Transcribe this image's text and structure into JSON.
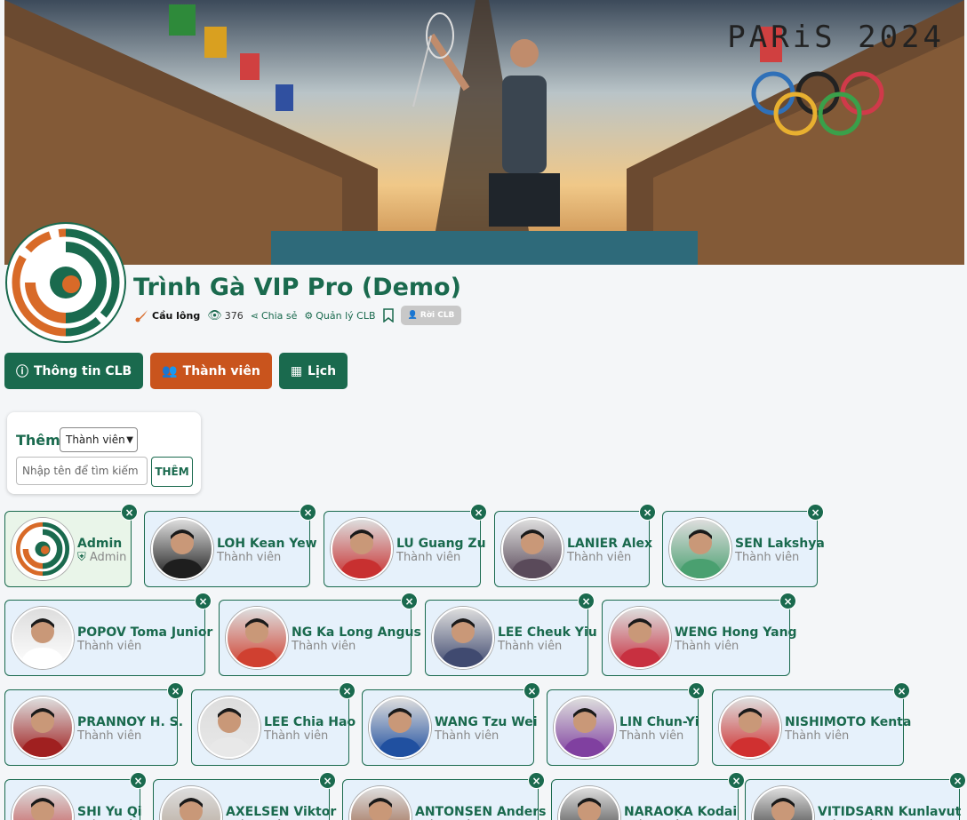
{
  "banner": {
    "watermark": "PARiS 2024"
  },
  "club": {
    "title": "Trình Gà VIP Pro (Demo)"
  },
  "meta": {
    "sport": "Cầu lông",
    "views": "376",
    "share": "Chia sẻ",
    "manage": "Quản lý CLB",
    "leave": "Rời CLB"
  },
  "tabs": [
    {
      "label": "Thông tin CLB",
      "icon": "info-icon"
    },
    {
      "label": "Thành viên",
      "icon": "users-icon"
    },
    {
      "label": "Lịch",
      "icon": "calendar-icon"
    }
  ],
  "add_panel": {
    "label": "Thêm",
    "role_selected": "Thành viên",
    "search_placeholder": "Nhập tên để tìm kiếm",
    "add_button": "THÊM"
  },
  "members": [
    {
      "name": "Admin",
      "role": "Admin"
    },
    {
      "name": "LOH Kean Yew",
      "role": "Thành viên"
    },
    {
      "name": "LU Guang Zu",
      "role": "Thành viên"
    },
    {
      "name": "LANIER Alex",
      "role": "Thành viên"
    },
    {
      "name": "SEN Lakshya",
      "role": "Thành viên"
    },
    {
      "name": "POPOV Toma Junior",
      "role": "Thành viên"
    },
    {
      "name": "NG Ka Long Angus",
      "role": "Thành viên"
    },
    {
      "name": "LEE Cheuk Yiu",
      "role": "Thành viên"
    },
    {
      "name": "WENG Hong Yang",
      "role": "Thành viên"
    },
    {
      "name": "PRANNOY H. S.",
      "role": "Thành viên"
    },
    {
      "name": "LEE Chia Hao",
      "role": "Thành viên"
    },
    {
      "name": "WANG Tzu Wei",
      "role": "Thành viên"
    },
    {
      "name": "LIN Chun-Yi",
      "role": "Thành viên"
    },
    {
      "name": "NISHIMOTO Kenta",
      "role": "Thành viên"
    },
    {
      "name": "SHI Yu Qi",
      "role": "Thành viên"
    },
    {
      "name": "AXELSEN Viktor",
      "role": "Thành viên"
    },
    {
      "name": "ANTONSEN Anders",
      "role": "Thành viên"
    },
    {
      "name": "NARAOKA Kodai",
      "role": "Thành viên"
    },
    {
      "name": "VITIDSARN Kunlavut",
      "role": "Thành viên"
    }
  ],
  "colors": {
    "primary": "#1a6a4e",
    "accent": "#c9541d"
  }
}
